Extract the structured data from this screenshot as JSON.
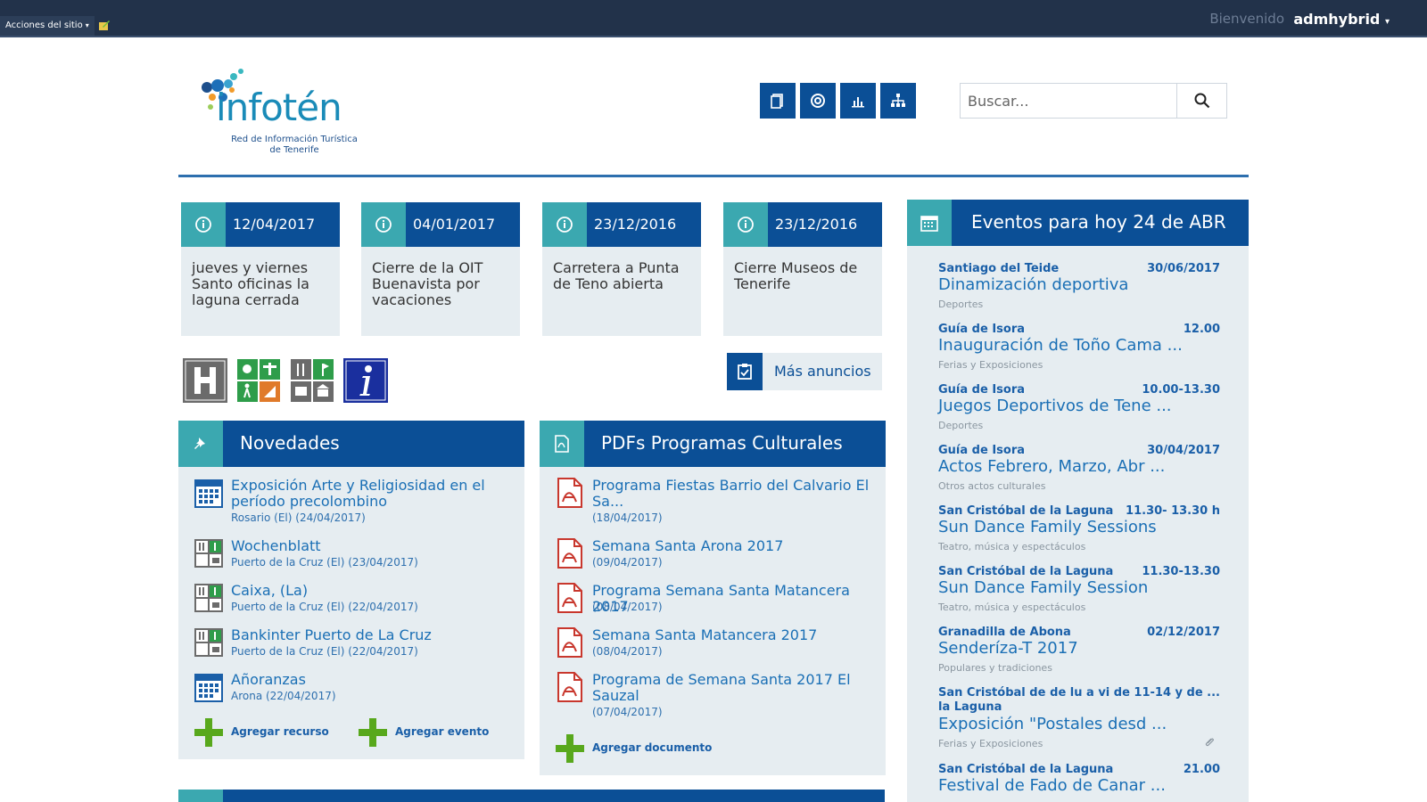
{
  "ribbon": {
    "site_actions": "Acciones del sitio",
    "welcome": "Bienvenido",
    "user": "admhybrid"
  },
  "header": {
    "logo_name": "infotén",
    "logo_sub_1": "Red de Información Turística",
    "logo_sub_2": "de Tenerife",
    "search_placeholder": "Buscar...",
    "toolbar_icons": [
      "document-icon",
      "support-icon",
      "chart-icon",
      "sitemap-icon"
    ]
  },
  "announcements": [
    {
      "date": "12/04/2017",
      "text": "jueves y viernes Santo oficinas la laguna cerrada"
    },
    {
      "date": "04/01/2017",
      "text": "Cierre de la OIT Buenavista por vacaciones"
    },
    {
      "date": "23/12/2016",
      "text": "Carretera a Punta de Teno abierta"
    },
    {
      "date": "23/12/2016",
      "text": "Cierre Museos de Tenerife"
    }
  ],
  "quick_icons": [
    "hotel-icon",
    "activities-icon",
    "services-icon",
    "info-icon"
  ],
  "more_announcements": "Más anuncios",
  "novedades": {
    "title": "Novedades",
    "items": [
      {
        "title_1": "Exposición Arte y Religiosidad en el",
        "title_2": "período precolombino",
        "sub": "Rosario (El) (24/04/2017)",
        "icon": "calendar"
      },
      {
        "title_1": "Wochenblatt",
        "title_2": "",
        "sub": "Puerto de la Cruz (El) (23/04/2017)",
        "icon": "resource"
      },
      {
        "title_1": "Caixa, (La)",
        "title_2": "",
        "sub": "Puerto de la Cruz (El) (22/04/2017)",
        "icon": "resource"
      },
      {
        "title_1": "Bankinter Puerto de La Cruz",
        "title_2": "",
        "sub": "Puerto de la Cruz (El) (22/04/2017)",
        "icon": "resource"
      },
      {
        "title_1": "Añoranzas",
        "title_2": "",
        "sub": "Arona (22/04/2017)",
        "icon": "calendar"
      }
    ],
    "add_resource": "Agregar recurso",
    "add_event": "Agregar evento"
  },
  "pdfs": {
    "title": "PDFs Programas Culturales",
    "items": [
      {
        "title_1": "Programa Fiestas Barrio del Calvario El",
        "title_2": "Sa...",
        "sub": "(18/04/2017)"
      },
      {
        "title_1": "Semana Santa Arona 2017",
        "title_2": "",
        "sub": "(09/04/2017)"
      },
      {
        "title_1": "Programa Semana Santa Matancera 2017",
        "title_2": "",
        "sub": "(08/04/2017)"
      },
      {
        "title_1": "Semana Santa Matancera 2017",
        "title_2": "",
        "sub": "(08/04/2017)"
      },
      {
        "title_1": "Programa de Semana Santa 2017 El",
        "title_2": "Sauzal",
        "sub": "(07/04/2017)"
      }
    ],
    "add_document": "Agregar documento"
  },
  "events": {
    "title": "Eventos para hoy 24 de ABR",
    "items": [
      {
        "place": "Santiago del Teide",
        "time": "30/06/2017",
        "title": "Dinamización deportiva",
        "cat": "Deportes"
      },
      {
        "place": "Guía de Isora",
        "time": "12.00",
        "title": "Inauguración de Toño Cama ...",
        "cat": "Ferias y Exposiciones"
      },
      {
        "place": "Guía de Isora",
        "time": "10.00-13.30",
        "title": "Juegos Deportivos de Tene ...",
        "cat": "Deportes"
      },
      {
        "place": "Guía de Isora",
        "time": "30/04/2017",
        "title": "Actos Febrero, Marzo, Abr ...",
        "cat": "Otros actos culturales"
      },
      {
        "place": "San Cristóbal de la Laguna",
        "time": "11.30- 13.30 h",
        "title": "Sun Dance Family Sessions",
        "cat": "Teatro, música y espectáculos"
      },
      {
        "place": "San Cristóbal de la Laguna",
        "time": "11.30-13.30",
        "title": "Sun Dance Family Session",
        "cat": "Teatro, música y espectáculos"
      },
      {
        "place": "Granadilla de Abona",
        "time": "02/12/2017",
        "title": "Senderíza-T 2017",
        "cat": "Populares y tradiciones"
      },
      {
        "place": "San Cristóbal de la Laguna",
        "time": "de lu a vi de 11-14 y de ...",
        "title": "Exposición \"Postales desd ...",
        "cat": "Ferias y Exposiciones"
      },
      {
        "place": "San Cristóbal de la Laguna",
        "time": "21.00",
        "title": "Festival de Fado de Canar ...",
        "cat": ""
      }
    ]
  },
  "colors": {
    "primary": "#0b4f96",
    "teal": "#3ba8b0",
    "panel_bg": "#e6edf1",
    "ribbon": "#22324a",
    "add_green": "#58a81c",
    "pdf_red": "#c8372d"
  }
}
